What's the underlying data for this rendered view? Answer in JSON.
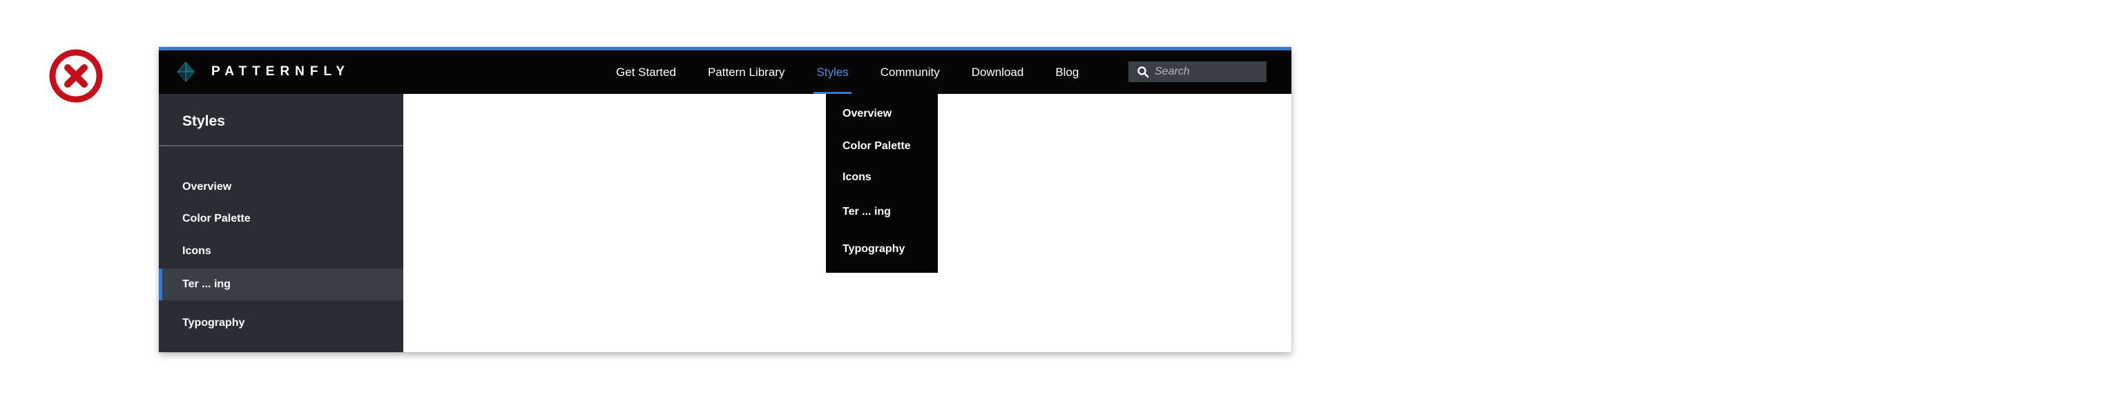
{
  "brand": {
    "name": "PATTERNFLY"
  },
  "nav": {
    "items": [
      {
        "label": "Get Started"
      },
      {
        "label": "Pattern Library"
      },
      {
        "label": "Styles"
      },
      {
        "label": "Community"
      },
      {
        "label": "Download"
      },
      {
        "label": "Blog"
      }
    ],
    "active": "Styles"
  },
  "search": {
    "placeholder": "Search"
  },
  "sidebar": {
    "title": "Styles",
    "items": [
      {
        "label": "Overview"
      },
      {
        "label": "Color Palette"
      },
      {
        "label": "Icons"
      },
      {
        "label": "Ter ... ing"
      },
      {
        "label": "Typography"
      }
    ],
    "active": "Ter ... ing"
  },
  "dropdown": {
    "items": [
      {
        "label": "Overview"
      },
      {
        "label": "Color Palette"
      },
      {
        "label": "Icons"
      },
      {
        "label": "Ter ... ing"
      },
      {
        "label": "Typography"
      }
    ]
  },
  "colors": {
    "status": "#c5101b",
    "accent": "#3b77c7",
    "navbar": "#050505",
    "sidebar": "#292e34"
  }
}
